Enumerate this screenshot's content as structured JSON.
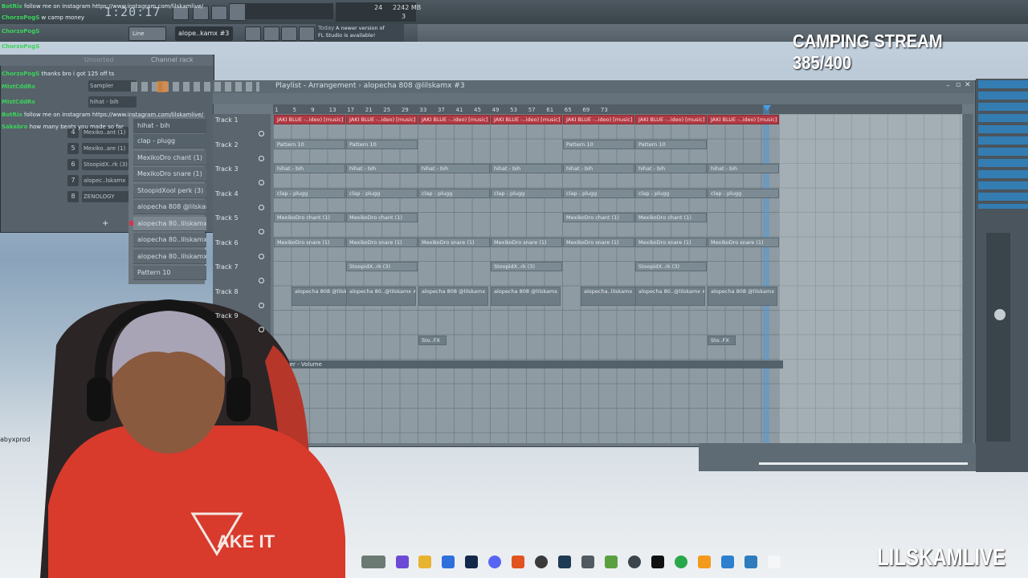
{
  "overlay": {
    "stream_title": "CAMPING STREAM 385/400",
    "streamer": "LILSKAMLIVE",
    "username_corner": "abyxprod"
  },
  "toolbar": {
    "clock": "1:20:17",
    "snap_mode": "Line",
    "pattern_selector": "alope..kamx #3",
    "cpu": "24",
    "memory": "2242 MB",
    "voices": "3",
    "news_label": "Today",
    "news_text": "A newer version of FL Studio is available!"
  },
  "chat": [
    {
      "user": "BotRix",
      "msg": "follow me on instagram https://www.instagram.com/lilskamlive/"
    },
    {
      "user": "ChorzoPogS",
      "msg": "w camp money"
    },
    {
      "user": "ChorzoPogS",
      "msg": ""
    },
    {
      "user": "ChorzoPogS",
      "msg": ""
    },
    {
      "user": "ChorzoPogS",
      "msg": "thanks bro i got 125 off ts"
    },
    {
      "user": "MistCddRx",
      "msg": ""
    },
    {
      "user": "MistCddRx",
      "msg": ""
    },
    {
      "user": "BotRix",
      "msg": "follow me on instagram https://www.instagram.com/lilskamlive/"
    },
    {
      "user": "Sakabro",
      "msg": "how many beats you made so far"
    }
  ],
  "channel_rack": {
    "title": "Channel rack",
    "filter": "Unsorted",
    "channels": [
      {
        "num": "",
        "name": "Sampler"
      },
      {
        "num": "",
        "name": "hihat - bih"
      },
      {
        "num": "4",
        "name": "Mexiko..ant (1)"
      },
      {
        "num": "5",
        "name": "Mexiko..are (1)"
      },
      {
        "num": "6",
        "name": "StoopidX..rk (3)"
      },
      {
        "num": "7",
        "name": "alopec..lskamx"
      },
      {
        "num": "8",
        "name": "ZENOLOGY"
      }
    ]
  },
  "picker": {
    "items": [
      "hihat - bih",
      "clap - plugg",
      "MexikoDro chant (1)",
      "MexikoDro snare (1)",
      "StoopidXool perk (3)",
      "alopecha 808 @lilskamx",
      "alopecha 80..lilskamx #3",
      "alopecha 80..lilskamx #2",
      "alopecha 80..lilskamx #4",
      "Pattern 10"
    ],
    "selected_index": 6
  },
  "playlist": {
    "title": "Playlist - Arrangement",
    "pattern": "alopecha 808 @lilskamx #3",
    "ruler": [
      "1",
      "5",
      "9",
      "13",
      "17",
      "21",
      "25",
      "29",
      "33",
      "37",
      "41",
      "45",
      "49",
      "53",
      "57",
      "61",
      "65",
      "69",
      "73"
    ],
    "tracks": [
      "Track 1",
      "Track 2",
      "Track 3",
      "Track 4",
      "Track 5",
      "Track 6",
      "Track 7",
      "Track 8",
      "Track 9"
    ],
    "clip_labels": {
      "t1": "JAKI BLUE -..ideo) [music]",
      "t2": "Pattern 10",
      "t3": "hihat - bih",
      "t4": "clap - plugg",
      "t5": "MexikoDro chant (1)",
      "t6": "MexikoDro snare (1)",
      "t7": "StoopidX..rk (3)",
      "t8a": "alopecha 808 @lilskamx",
      "t8b": "alopecha 80..@lilskamx #2",
      "t8c": "alopecha 808 @lilskamx #3",
      "t8d": "alopecha 808 @lilskamx #4",
      "t8e": "alopecha..lilskamx",
      "t8f": "alopecha 80..@lilskamx #2",
      "t10": "Sto..FX"
    },
    "automation": "Master - Volume"
  },
  "colors": {
    "audio_clip": "#b03a44",
    "accent": "#3ad45a",
    "playhead": "#4696dc"
  }
}
